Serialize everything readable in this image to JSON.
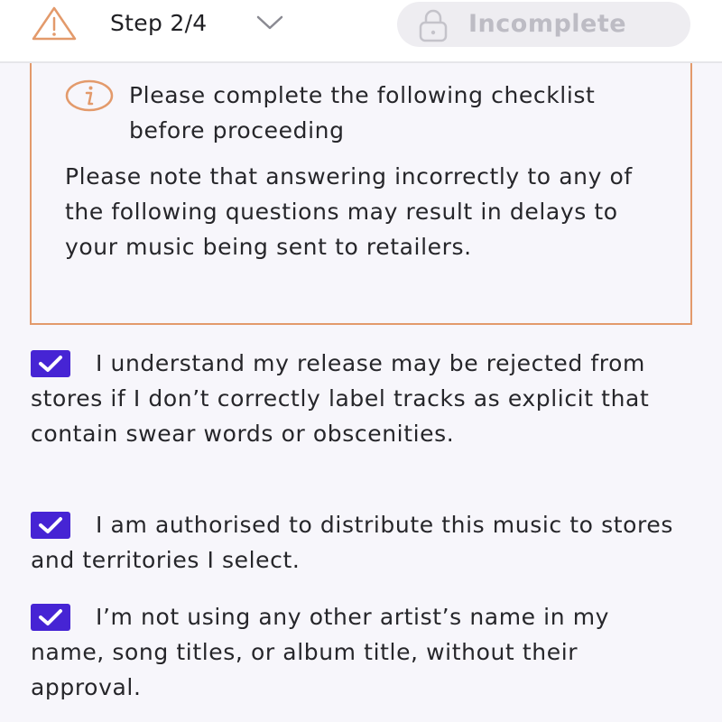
{
  "header": {
    "step_label": "Step 2/4",
    "status_label": "Incomplete",
    "icons": {
      "warning": "warning-triangle-icon",
      "chevron": "chevron-down-icon",
      "lock": "lock-icon"
    }
  },
  "notice": {
    "icon": "info-circle-icon",
    "title": "Please complete the following checklist before proceeding",
    "body": "Please note that answering incorrectly to any of the following questions may result in delays to your music being sent to retailers."
  },
  "checklist": [
    {
      "checked": true,
      "text": "I understand my release may be rejected from stores if I don’t correctly label tracks as explicit that contain swear words or obscenities."
    },
    {
      "checked": true,
      "text": "I am authorised to distribute this music to stores and territories I select."
    },
    {
      "checked": true,
      "text": "I’m not using any other artist’s name in my name, song titles, or album title, without their approval."
    }
  ],
  "colors": {
    "accent": "#4624d4",
    "notice_border": "#e39a6b",
    "background": "#f7f6fb",
    "pill_background": "#eeedf1",
    "pill_text": "#bdbcc4"
  }
}
